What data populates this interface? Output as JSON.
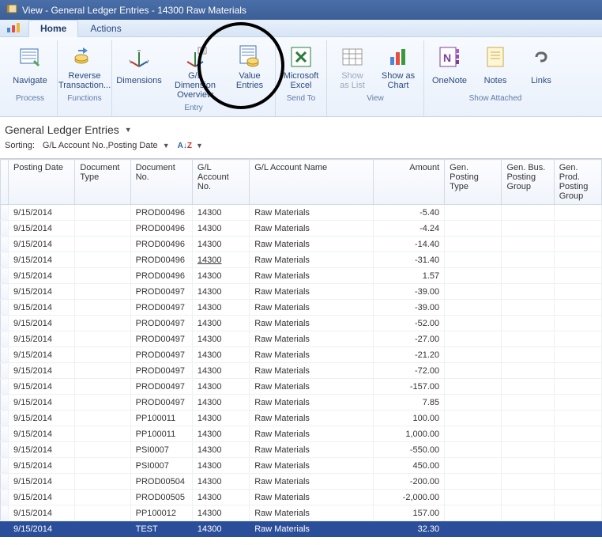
{
  "title": "View - General Ledger Entries - 14300 Raw Materials",
  "tabs": {
    "home": "Home",
    "actions": "Actions"
  },
  "ribbon": {
    "navigate": "Navigate",
    "reverse": "Reverse\nTransaction...",
    "dimensions": "Dimensions",
    "gl_dim": "G/L Dimension\nOverview",
    "value_entries": "Value\nEntries",
    "excel": "Microsoft\nExcel",
    "show_list": "Show\nas List",
    "show_chart": "Show as\nChart",
    "onenote": "OneNote",
    "notes": "Notes",
    "links": "Links",
    "grp_process": "Process",
    "grp_functions": "Functions",
    "grp_entry": "Entry",
    "grp_sendto": "Send To",
    "grp_view": "View",
    "grp_attached": "Show Attached"
  },
  "sub_hdr": "General Ledger Entries",
  "sort_lbl": "Sorting:",
  "sort_val": "G/L Account No.,Posting Date",
  "columns": {
    "posting_date": "Posting Date",
    "doc_type": "Document Type",
    "doc_no": "Document No.",
    "gl_no": "G/L Account No.",
    "gl_name": "G/L Account Name",
    "amount": "Amount",
    "gen_type": "Gen. Posting Type",
    "gen_bus": "Gen. Bus. Posting Group",
    "gen_prod": "Gen. Prod. Posting Group"
  },
  "rows": [
    {
      "date": "9/15/2014",
      "docno": "PROD00496",
      "gl": "14300",
      "name": "Raw Materials",
      "amt": "-5.40"
    },
    {
      "date": "9/15/2014",
      "docno": "PROD00496",
      "gl": "14300",
      "name": "Raw Materials",
      "amt": "-4.24"
    },
    {
      "date": "9/15/2014",
      "docno": "PROD00496",
      "gl": "14300",
      "name": "Raw Materials",
      "amt": "-14.40"
    },
    {
      "date": "9/15/2014",
      "docno": "PROD00496",
      "gl": "14300",
      "name": "Raw Materials",
      "amt": "-31.40",
      "gl_underline": true
    },
    {
      "date": "9/15/2014",
      "docno": "PROD00496",
      "gl": "14300",
      "name": "Raw Materials",
      "amt": "1.57"
    },
    {
      "date": "9/15/2014",
      "docno": "PROD00497",
      "gl": "14300",
      "name": "Raw Materials",
      "amt": "-39.00"
    },
    {
      "date": "9/15/2014",
      "docno": "PROD00497",
      "gl": "14300",
      "name": "Raw Materials",
      "amt": "-39.00"
    },
    {
      "date": "9/15/2014",
      "docno": "PROD00497",
      "gl": "14300",
      "name": "Raw Materials",
      "amt": "-52.00"
    },
    {
      "date": "9/15/2014",
      "docno": "PROD00497",
      "gl": "14300",
      "name": "Raw Materials",
      "amt": "-27.00"
    },
    {
      "date": "9/15/2014",
      "docno": "PROD00497",
      "gl": "14300",
      "name": "Raw Materials",
      "amt": "-21.20"
    },
    {
      "date": "9/15/2014",
      "docno": "PROD00497",
      "gl": "14300",
      "name": "Raw Materials",
      "amt": "-72.00"
    },
    {
      "date": "9/15/2014",
      "docno": "PROD00497",
      "gl": "14300",
      "name": "Raw Materials",
      "amt": "-157.00"
    },
    {
      "date": "9/15/2014",
      "docno": "PROD00497",
      "gl": "14300",
      "name": "Raw Materials",
      "amt": "7.85"
    },
    {
      "date": "9/15/2014",
      "docno": "PP100011",
      "gl": "14300",
      "name": "Raw Materials",
      "amt": "100.00"
    },
    {
      "date": "9/15/2014",
      "docno": "PP100011",
      "gl": "14300",
      "name": "Raw Materials",
      "amt": "1,000.00"
    },
    {
      "date": "9/15/2014",
      "docno": "PSI0007",
      "gl": "14300",
      "name": "Raw Materials",
      "amt": "-550.00"
    },
    {
      "date": "9/15/2014",
      "docno": "PSI0007",
      "gl": "14300",
      "name": "Raw Materials",
      "amt": "450.00"
    },
    {
      "date": "9/15/2014",
      "docno": "PROD00504",
      "gl": "14300",
      "name": "Raw Materials",
      "amt": "-200.00"
    },
    {
      "date": "9/15/2014",
      "docno": "PROD00505",
      "gl": "14300",
      "name": "Raw Materials",
      "amt": "-2,000.00"
    },
    {
      "date": "9/15/2014",
      "docno": "PP100012",
      "gl": "14300",
      "name": "Raw Materials",
      "amt": "157.00"
    },
    {
      "date": "9/15/2014",
      "docno": "TEST",
      "gl": "14300",
      "name": "Raw Materials",
      "amt": "32.30",
      "selected": true
    }
  ]
}
